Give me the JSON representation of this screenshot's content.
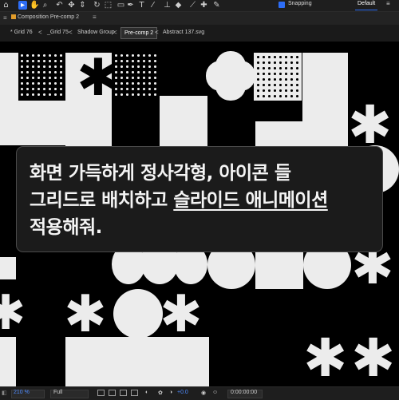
{
  "toolbar": {
    "tools": [
      "▶",
      "✋",
      "🔍",
      "↶",
      "✥",
      "↻",
      "⬚",
      "⌘",
      "T",
      "✎",
      "⚲",
      "◆",
      "✦"
    ],
    "snapping_label": "Snapping",
    "workspace": "Default",
    "workspace_more": "≡",
    "accent": "#2d6df6"
  },
  "comp_panel": {
    "menu": "≡",
    "title": "Composition Pre-comp 2",
    "close": "≡"
  },
  "breadcrumbs": {
    "items": [
      "* Grid 76",
      "_Grid 75",
      "Shadow Group",
      "Pre-comp 2",
      "Abstract 137.svg"
    ],
    "current_index": 3,
    "separator": "<"
  },
  "chat": {
    "line1": "화면 가득하게 정사각형, 아이콘 들",
    "line2_plain": "그리드로 배치하고 ",
    "line2_underlined": "슬라이드 애니메이션",
    "line3": "적용해줘."
  },
  "bottom_bar": {
    "zoom": "210 %",
    "resolution": "Full",
    "exposure": "+0.0",
    "timecode": "0:00:00:00",
    "menu": "≡"
  }
}
